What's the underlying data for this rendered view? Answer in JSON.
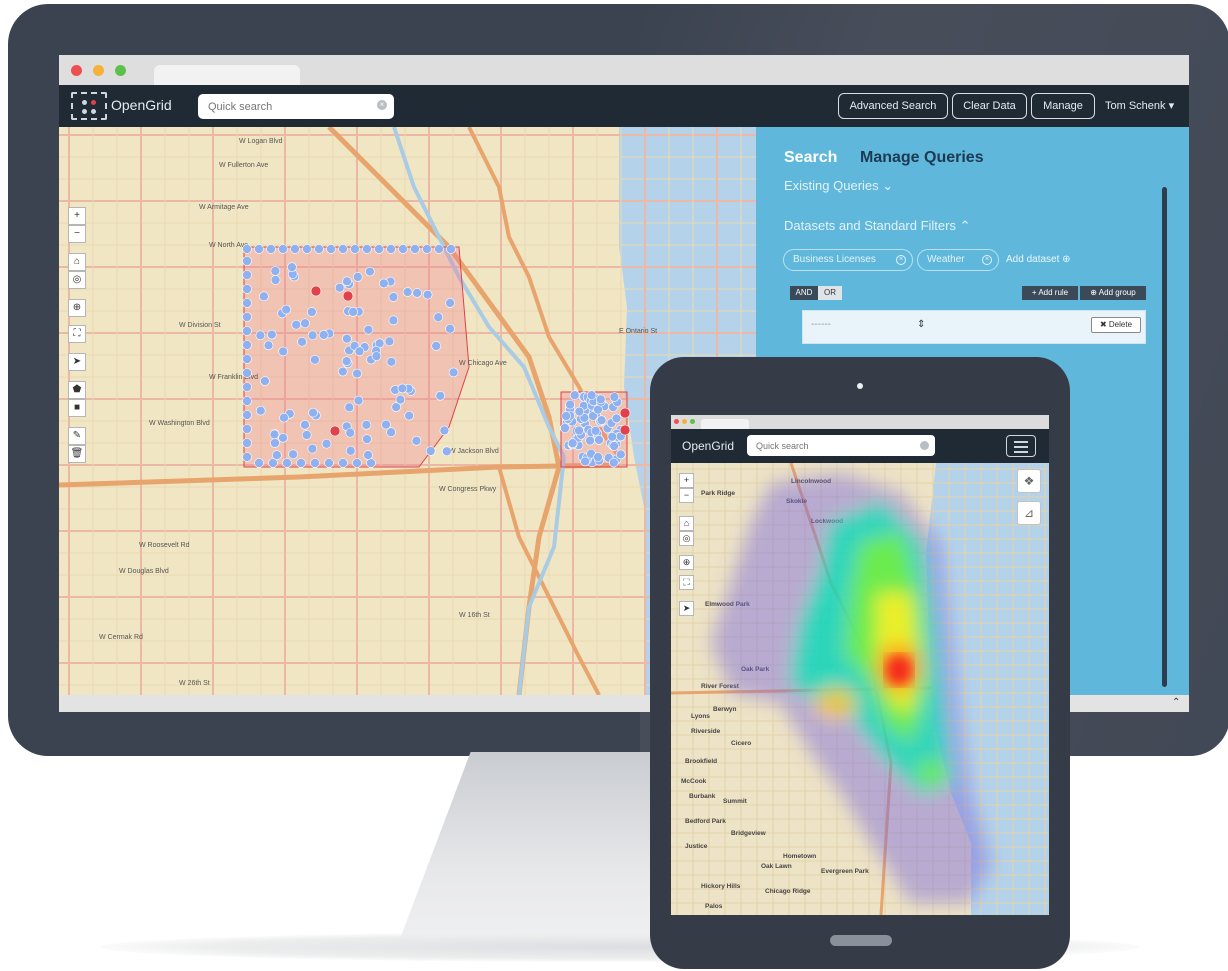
{
  "desktop": {
    "app_title": "OpenGrid",
    "search": {
      "placeholder": "Quick search"
    },
    "nav": {
      "advanced_search": "Advanced Search",
      "clear_data": "Clear Data",
      "manage": "Manage",
      "user": "Tom Schenk ▾"
    },
    "panel": {
      "tab_search": "Search",
      "tab_manage": "Manage Queries",
      "existing_queries": "Existing Queries ⌄",
      "datasets_heading": "Datasets and Standard Filters ⌃",
      "datasets": [
        "Business Licenses",
        "Weather"
      ],
      "add_dataset": "Add dataset ⊕",
      "and_label": "AND",
      "or_label": "OR",
      "add_rule": "+ Add rule",
      "add_group": "⊕ Add group",
      "rule_placeholder": "------",
      "delete": "✖ Delete"
    },
    "map_labels": [
      "W Logan Blvd",
      "W Fullerton Ave",
      "W Armitage Ave",
      "W North Ave",
      "W Division St",
      "W Chicago Ave",
      "W Franklin Blvd",
      "W Washington Blvd",
      "W Jackson Blvd",
      "W Congress Pkwy",
      "W Roosevelt Rd",
      "W Douglas Blvd",
      "W Cermak Rd",
      "W 26th St",
      "W 16th St",
      "E Ontario St"
    ],
    "colors": {
      "navbar": "#1f2a35",
      "panel": "#5fb8dc",
      "marker": "#8fb1f0",
      "marker_selected": "#e0414a"
    }
  },
  "tablet": {
    "app_title": "OpenGrid",
    "search": {
      "placeholder": "Quick search"
    },
    "map_labels": [
      "Park Ridge",
      "Elmwood Park",
      "Oak Park",
      "Berwyn",
      "Cicero",
      "Riverside",
      "Summit",
      "Evergreen Park",
      "Oak Lawn",
      "Chicago Ridge",
      "Hickory Hills",
      "Palos",
      "Burbank",
      "Bedford Park",
      "Justice",
      "Hometown",
      "Lincolnwood",
      "Skokie",
      "Lockwood",
      "Bridgeview",
      "River Forest",
      "McCook",
      "Brookfield",
      "Lyons"
    ]
  }
}
